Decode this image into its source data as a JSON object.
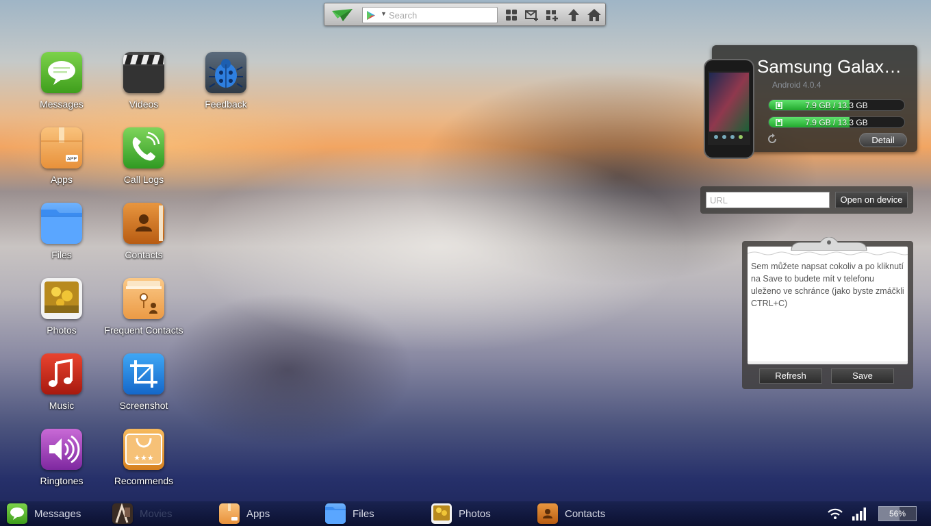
{
  "toolbar": {
    "search_placeholder": "Search",
    "buttons": [
      "grid-icon",
      "new-message-icon",
      "add-app-icon",
      "upload-icon",
      "home-icon"
    ]
  },
  "desktop": {
    "apps": [
      {
        "label": "Messages",
        "icon": "messages-icon"
      },
      {
        "label": "Videos",
        "icon": "videos-icon"
      },
      {
        "label": "Feedback",
        "icon": "feedback-icon"
      },
      {
        "label": "Apps",
        "icon": "apps-icon"
      },
      {
        "label": "Call Logs",
        "icon": "call-logs-icon"
      },
      {
        "label": "Files",
        "icon": "files-icon"
      },
      {
        "label": "Contacts",
        "icon": "contacts-icon"
      },
      {
        "label": "Photos",
        "icon": "photos-icon"
      },
      {
        "label": "Frequent Contacts",
        "icon": "frequent-contacts-icon"
      },
      {
        "label": "Music",
        "icon": "music-icon"
      },
      {
        "label": "Screenshot",
        "icon": "screenshot-icon"
      },
      {
        "label": "Ringtones",
        "icon": "ringtones-icon"
      },
      {
        "label": "Recommends",
        "icon": "recommends-icon"
      }
    ]
  },
  "device": {
    "name": "Samsung Galaxy Nexus",
    "os": "Android 4.0.4",
    "storage": [
      {
        "text": "7.9 GB / 13.3 GB",
        "fraction": 0.594,
        "icon": "phone-storage-icon"
      },
      {
        "text": "7.9 GB / 13.3 GB",
        "fraction": 0.594,
        "icon": "sd-card-icon"
      }
    ],
    "detail_label": "Detail"
  },
  "url": {
    "placeholder": "URL",
    "open_label": "Open on device"
  },
  "clipboard": {
    "text": "Sem můžete napsat cokoliv a po kliknutí na Save to budete mít v telefonu uleženo ve schránce (jako byste zmáčkli CTRL+C)",
    "refresh_label": "Refresh",
    "save_label": "Save"
  },
  "taskbar": {
    "tasks": [
      {
        "label": "Messages",
        "icon": "messages-icon"
      },
      {
        "label": "Movies",
        "icon": "movies-icon"
      },
      {
        "label": "Apps",
        "icon": "apps-icon"
      },
      {
        "label": "Files",
        "icon": "files-icon"
      },
      {
        "label": "Photos",
        "icon": "photos-icon"
      },
      {
        "label": "Contacts",
        "icon": "contacts-icon"
      }
    ],
    "battery": "56%",
    "battery_fraction": 0.56
  },
  "colors": {
    "accent_green": "#2fbd3a",
    "panel_dark": "#2a2a28"
  }
}
